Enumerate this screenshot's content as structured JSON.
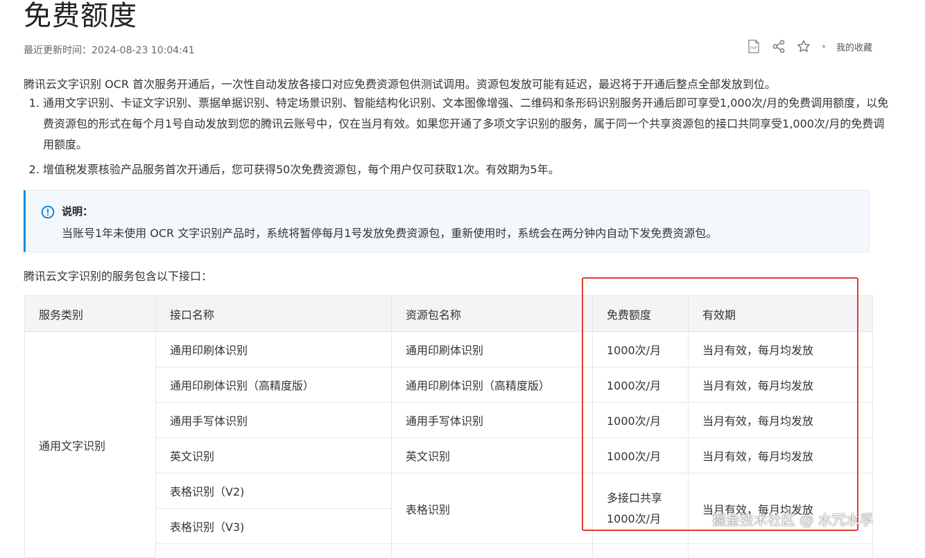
{
  "page": {
    "title": "免费额度",
    "updated": "最近更新时间：2024-08-23 10:04:41",
    "toolbar": {
      "pdf_icon": "pdf-icon",
      "share_icon": "share-icon",
      "star_icon": "star-icon",
      "favorites_label": "我的收藏"
    }
  },
  "intro": "腾讯云文字识别 OCR 首次服务开通后，一次性自动发放各接口对应免费资源包供测试调用。资源包发放可能有延迟，最迟将于开通后整点全部发放到位。",
  "list": [
    "通用文字识别、卡证文字识别、票据单据识别、特定场景识别、智能结构化识别、文本图像增强、二维码和条形码识别服务开通后即可享受1,000次/月的免费调用额度，以免费资源包的形式在每个月1号自动发放到您的腾讯云账号中，仅在当月有效。如果您开通了多项文字识别的服务，属于同一个共享资源包的接口共同享受1,000次/月的免费调用额度。",
    "增值税发票核验产品服务首次开通后，您可获得50次免费资源包，每个用户仅可获取1次。有效期为5年。"
  ],
  "note": {
    "icon": "info-icon",
    "title": "说明：",
    "body": "当账号1年未使用 OCR 文字识别产品时，系统将暂停每月1号发放免费资源包，重新使用时，系统会在两分钟内自动下发免费资源包。"
  },
  "caption": "腾讯云文字识别的服务包含以下接口：",
  "table": {
    "headers": [
      "服务类别",
      "接口名称",
      "资源包名称",
      "免费额度",
      "有效期"
    ],
    "category": "通用文字识别",
    "rows": [
      {
        "api": "通用印刷体识别",
        "package": "通用印刷体识别",
        "quota": "1000次/月",
        "validity": "当月有效，每月均发放"
      },
      {
        "api": "通用印刷体识别（高精度版）",
        "package": "通用印刷体识别（高精度版）",
        "quota": "1000次/月",
        "validity": "当月有效，每月均发放"
      },
      {
        "api": "通用手写体识别",
        "package": "通用手写体识别",
        "quota": "1000次/月",
        "validity": "当月有效，每月均发放"
      },
      {
        "api": "英文识别",
        "package": "英文识别",
        "quota": "1000次/月",
        "validity": "当月有效，每月均发放"
      }
    ],
    "merged": {
      "apis": [
        "表格识别（V2)",
        "表格识别（V3)"
      ],
      "package": "表格识别",
      "quota_line1": "多接口共享",
      "quota_line2": "1000次/月",
      "validity": "当月有效，每月均发放"
    }
  },
  "watermark": "掘金技术社区 @ 水冗水孚",
  "colors": {
    "highlight": "#e03a32",
    "note_accent": "#1b88d4",
    "header_bg": "#f2f4f6"
  }
}
